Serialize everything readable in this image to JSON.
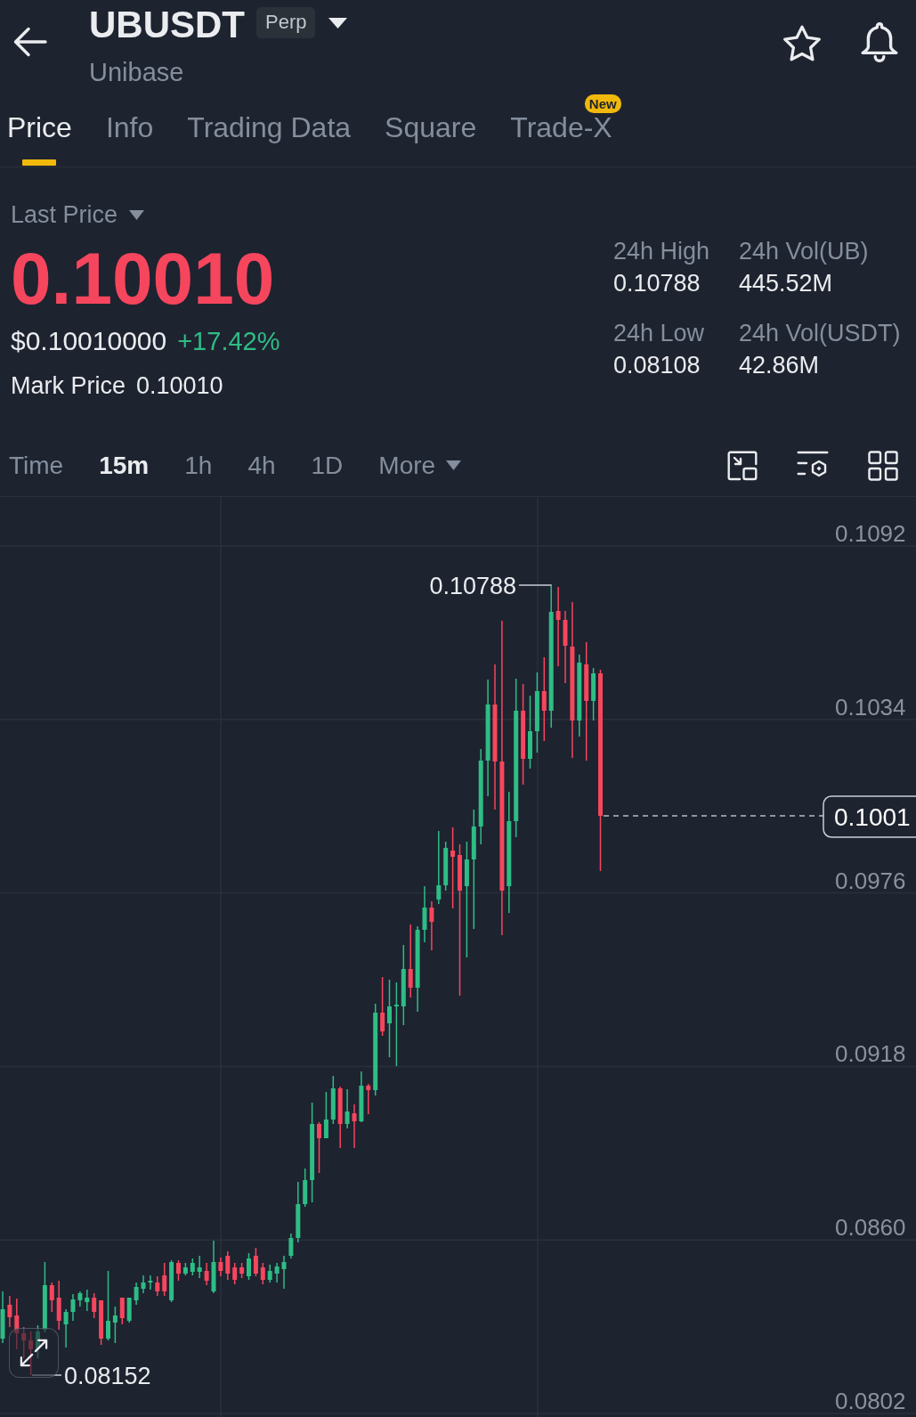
{
  "header": {
    "symbol": "UBUSDT",
    "contract_badge": "Perp",
    "name": "Unibase",
    "favorite": false
  },
  "tabs": [
    {
      "label": "Price",
      "selected": true
    },
    {
      "label": "Info",
      "selected": false
    },
    {
      "label": "Trading Data",
      "selected": false
    },
    {
      "label": "Square",
      "selected": false
    },
    {
      "label": "Trade-X",
      "selected": false,
      "badge": "New"
    }
  ],
  "price_panel": {
    "price_type": "Last Price",
    "last_price": {
      "value": "0.10010",
      "rising": false
    },
    "usd_price": "$0.10010000",
    "change": {
      "value": "+17.42%",
      "rising": true
    },
    "mark_price": {
      "label": "Mark Price",
      "value": "0.10010"
    },
    "stats": [
      {
        "label": "24h High",
        "value": "0.10788"
      },
      {
        "label": "24h Vol(UB)",
        "value": "445.52M"
      },
      {
        "label": "24h Low",
        "value": "0.08108"
      },
      {
        "label": "24h Vol(USDT)",
        "value": "42.86M"
      }
    ]
  },
  "intervals": [
    {
      "label": "Time",
      "selected": false,
      "kind": "option"
    },
    {
      "label": "15m",
      "selected": true,
      "kind": "option"
    },
    {
      "label": "1h",
      "selected": false,
      "kind": "option"
    },
    {
      "label": "4h",
      "selected": false,
      "kind": "option"
    },
    {
      "label": "1D",
      "selected": false,
      "kind": "option"
    },
    {
      "label": "More",
      "selected": false,
      "kind": "dropdown"
    }
  ],
  "chart": {
    "price_labels": [
      "0.1092",
      "0.1034",
      "0.0976",
      "0.0918",
      "0.0860",
      "0.0802"
    ],
    "high_marker": "0.10788",
    "low_marker": "0.08152",
    "current_price": "0.1001"
  }
}
